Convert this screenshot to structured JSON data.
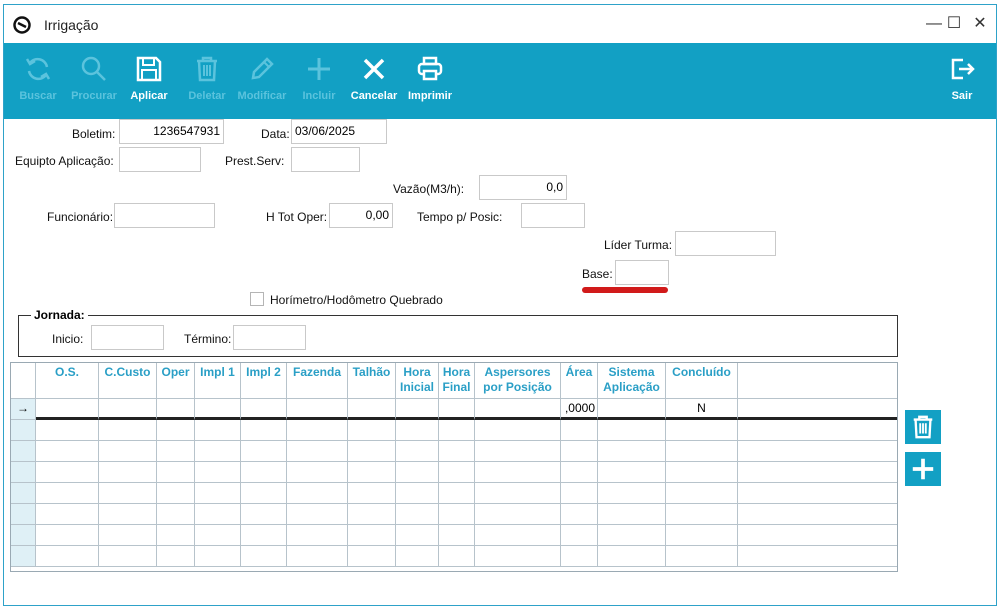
{
  "window": {
    "title": "Irrigação",
    "controls": {
      "minimize": "—",
      "maximize": "☐",
      "close": "✕"
    }
  },
  "toolbar": {
    "buttons": [
      {
        "id": "buscar",
        "label": "Buscar",
        "icon": "refresh-icon",
        "enabled": false
      },
      {
        "id": "procurar",
        "label": "Procurar",
        "icon": "search-icon",
        "enabled": false
      },
      {
        "id": "aplicar",
        "label": "Aplicar",
        "icon": "save-icon",
        "enabled": true
      },
      {
        "id": "deletar",
        "label": "Deletar",
        "icon": "trash-icon",
        "enabled": false
      },
      {
        "id": "modificar",
        "label": "Modificar",
        "icon": "pencil-icon",
        "enabled": false
      },
      {
        "id": "incluir",
        "label": "Incluir",
        "icon": "plus-icon",
        "enabled": false
      },
      {
        "id": "cancelar",
        "label": "Cancelar",
        "icon": "x-icon",
        "enabled": true
      },
      {
        "id": "imprimir",
        "label": "Imprimir",
        "icon": "printer-icon",
        "enabled": true
      }
    ],
    "exit": {
      "label": "Sair",
      "icon": "exit-icon"
    }
  },
  "form": {
    "boletim": {
      "label": "Boletim:",
      "value": "1236547931"
    },
    "data": {
      "label": "Data:",
      "value": "03/06/2025"
    },
    "equipto": {
      "label": "Equipto Aplicação:",
      "value": ""
    },
    "prest_serv": {
      "label": "Prest.Serv:",
      "value": ""
    },
    "vazao": {
      "label": "Vazão(M3/h):",
      "value": "0,0"
    },
    "funcionario": {
      "label": "Funcionário:",
      "value": ""
    },
    "h_tot_oper": {
      "label": "H Tot Oper:",
      "value": "0,00"
    },
    "tempo_posic": {
      "label": "Tempo p/ Posic:",
      "value": ""
    },
    "lider_turma": {
      "label": "Líder Turma:",
      "value": ""
    },
    "base": {
      "label": "Base:",
      "value": ""
    },
    "horimetro": {
      "label": "Horímetro/Hodômetro Quebrado",
      "checked": false
    }
  },
  "jornada": {
    "title": "Jornada:",
    "inicio": {
      "label": "Inicio:",
      "value": ""
    },
    "termino": {
      "label": "Término:",
      "value": ""
    }
  },
  "table": {
    "columns": [
      "O.S.",
      "C.Custo",
      "Oper",
      "Impl 1",
      "Impl 2",
      "Fazenda",
      "Talhão",
      "Hora Inicial",
      "Hora Final",
      "Aspersores por Posição",
      "Área",
      "Sistema Aplicação",
      "Concluído"
    ],
    "rows": [
      {
        "indicator": "→",
        "cells": [
          "",
          "",
          "",
          "",
          "",
          "",
          "",
          "",
          "",
          "",
          ",0000",
          "",
          "N"
        ]
      }
    ]
  },
  "colors": {
    "accent": "#12a0c4",
    "header_text": "#2a9fc6",
    "highlight": "#d11a1a"
  }
}
